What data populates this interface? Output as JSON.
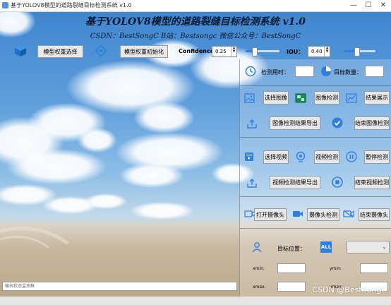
{
  "window": {
    "title": "基于YOLOV8模型的道路裂缝目标检测系统 v1.0",
    "minimize": "—",
    "maximize": "☐",
    "close": "✕"
  },
  "header": {
    "title": "基于YOLOV8模型的道路裂缝目标检测系统 v1.0",
    "subtitle": "CSDN：BestSongC   B站：Bestsongc   微信公众号：BestSongC"
  },
  "model": {
    "select_weights_label": "模型权重选择",
    "init_weights_label": "模型权重初始化",
    "confidence_label": "Confidence",
    "confidence_value": "0.25",
    "confidence_level": 0.25,
    "iou_label": "IOU：",
    "iou_value": "0.40",
    "iou_level": 0.4
  },
  "stats": {
    "time_label": "检测用时：",
    "time_value": "",
    "count_label": "目标数量：",
    "count_value": ""
  },
  "image_section": {
    "select_label": "选择图像",
    "detect_label": "图像检测",
    "show_label": "结果展示",
    "export_label": "图像检测结果导出",
    "end_label": "结束图像检测"
  },
  "video_section": {
    "select_label": "选择视频",
    "detect_label": "视频检测",
    "pause_label": "暂停检测",
    "export_label": "视频检测结果导出",
    "end_label": "结束视频检测"
  },
  "camera_section": {
    "open_label": "打开摄像头",
    "detect_label": "摄像头检测",
    "end_label": "结束摄像头"
  },
  "target": {
    "position_label": "目标位置：",
    "all_label": "ALL",
    "select_value": "",
    "xmin_label": "xmin:",
    "ymin_label": "ymin:",
    "xmax_label": "xmax:",
    "ymax_label": "ymax:"
  },
  "status": {
    "placeholder": "输出状态监测框"
  },
  "watermark": "CSDN @BestSongC",
  "colors": {
    "accent_blue": "#2f7fe0",
    "title_text": "#0b1a33",
    "button_bg": "#e8e8e8"
  }
}
